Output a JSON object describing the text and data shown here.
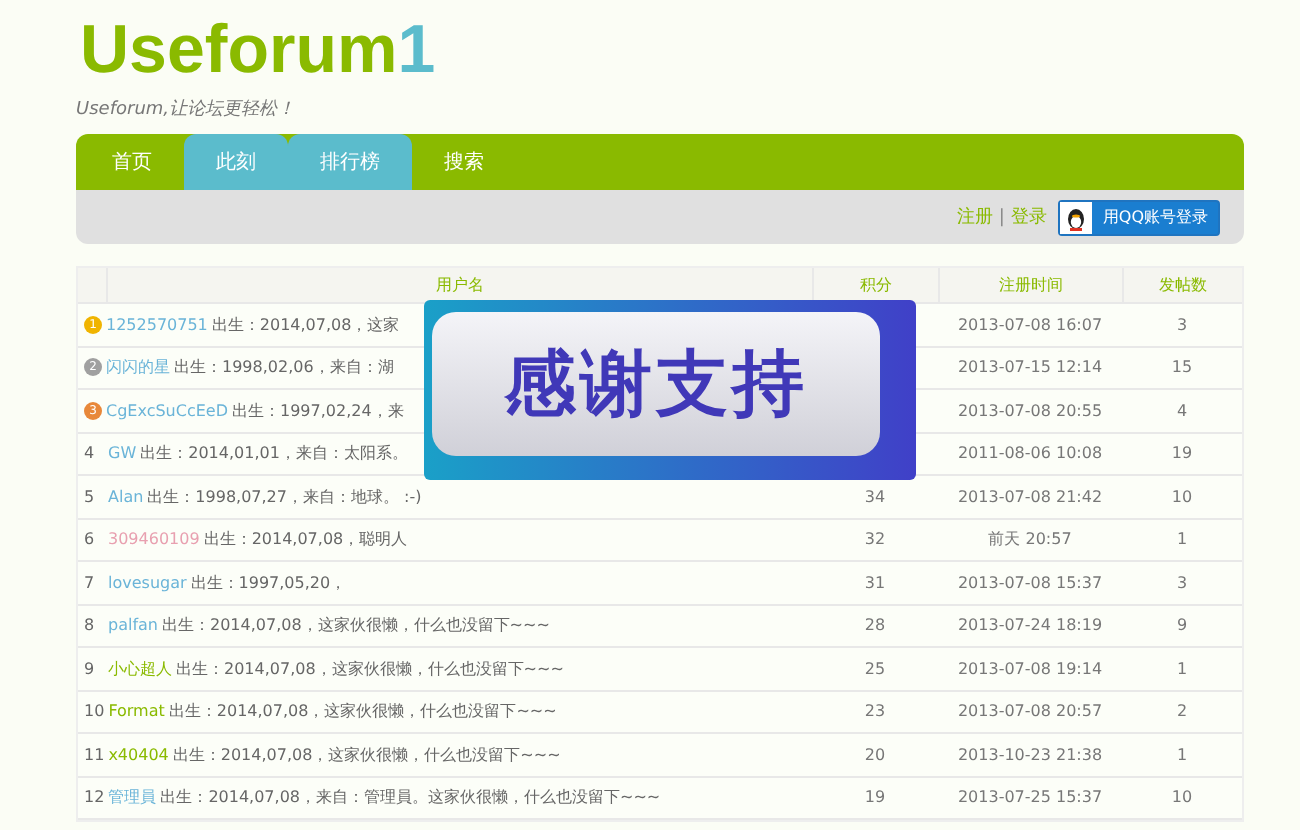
{
  "logo": {
    "main": "Useforum",
    "suffix": "1"
  },
  "tagline": "Useforum,让论坛更轻松！",
  "nav": [
    {
      "label": "首页",
      "selected": false
    },
    {
      "label": "此刻",
      "selected": true
    },
    {
      "label": "排行榜",
      "selected": true
    },
    {
      "label": "搜索",
      "selected": false
    }
  ],
  "account": {
    "register": "注册",
    "separator": "|",
    "login": "登录",
    "qq_button": "用QQ账号登录"
  },
  "table": {
    "columns": [
      "用户名",
      "积分",
      "注册时间",
      "发帖数"
    ],
    "rows": [
      {
        "rank": {
          "kind": "medal",
          "number": "1",
          "color": "#f0b400"
        },
        "name": "1252570751",
        "color": "#6ab4d8",
        "bio": "出生：2014,07,08，这家",
        "score": "",
        "registered": "2013-07-08 16:07",
        "posts": "3"
      },
      {
        "rank": {
          "kind": "medal",
          "number": "2",
          "color": "#a0a0a0"
        },
        "name": "闪闪的星",
        "color": "#6ab4d8",
        "bio": "出生：1998,02,06，来自：湖",
        "score": "",
        "registered": "2013-07-15 12:14",
        "posts": "15"
      },
      {
        "rank": {
          "kind": "medal",
          "number": "3",
          "color": "#e8883a"
        },
        "name": "CgExcSuCcEeD",
        "color": "#6ab4d8",
        "bio": "出生：1997,02,24，来",
        "score": "",
        "registered": "2013-07-08 20:55",
        "posts": "4"
      },
      {
        "rank": {
          "kind": "plain",
          "number": "4"
        },
        "name": "GW",
        "color": "#6ab4d8",
        "bio": "出生：2014,01,01，来自：太阳系。",
        "score": "",
        "registered": "2011-08-06 10:08",
        "posts": "19"
      },
      {
        "rank": {
          "kind": "plain",
          "number": "5"
        },
        "name": "Alan",
        "color": "#6ab4d8",
        "bio": "出生：1998,07,27，来自：地球。 :-)",
        "score": "34",
        "registered": "2013-07-08 21:42",
        "posts": "10"
      },
      {
        "rank": {
          "kind": "plain",
          "number": "6"
        },
        "name": "309460109",
        "color": "#e8a0b0",
        "bio": "出生：2014,07,08，聪明人",
        "score": "32",
        "registered": "前天 20:57",
        "posts": "1"
      },
      {
        "rank": {
          "kind": "plain",
          "number": "7"
        },
        "name": "lovesugar",
        "color": "#6ab4d8",
        "bio": "出生：1997,05,20，",
        "score": "31",
        "registered": "2013-07-08 15:37",
        "posts": "3"
      },
      {
        "rank": {
          "kind": "plain",
          "number": "8"
        },
        "name": "palfan",
        "color": "#6ab4d8",
        "bio": "出生：2014,07,08，这家伙很懒，什么也没留下~~~",
        "score": "28",
        "registered": "2013-07-24 18:19",
        "posts": "9"
      },
      {
        "rank": {
          "kind": "plain",
          "number": "9"
        },
        "name": "小心超人",
        "color": "#8aba00",
        "bio": "出生：2014,07,08，这家伙很懒，什么也没留下~~~",
        "score": "25",
        "registered": "2013-07-08 19:14",
        "posts": "1"
      },
      {
        "rank": {
          "kind": "plain",
          "number": "10"
        },
        "name": "Format",
        "color": "#8aba00",
        "bio": "出生：2014,07,08，这家伙很懒，什么也没留下~~~",
        "score": "23",
        "registered": "2013-07-08 20:57",
        "posts": "2"
      },
      {
        "rank": {
          "kind": "plain",
          "number": "11"
        },
        "name": "x40404",
        "color": "#8aba00",
        "bio": "出生：2014,07,08，这家伙很懒，什么也没留下~~~",
        "score": "20",
        "registered": "2013-10-23 21:38",
        "posts": "1"
      },
      {
        "rank": {
          "kind": "plain",
          "number": "12"
        },
        "name": "管理員",
        "color": "#6ab4d8",
        "bio": "出生：2014,07,08，来自：管理員。这家伙很懒，什么也没留下~~~",
        "score": "19",
        "registered": "2013-07-25 15:37",
        "posts": "10"
      }
    ]
  },
  "overlay_banner": {
    "text": "感谢支持"
  }
}
